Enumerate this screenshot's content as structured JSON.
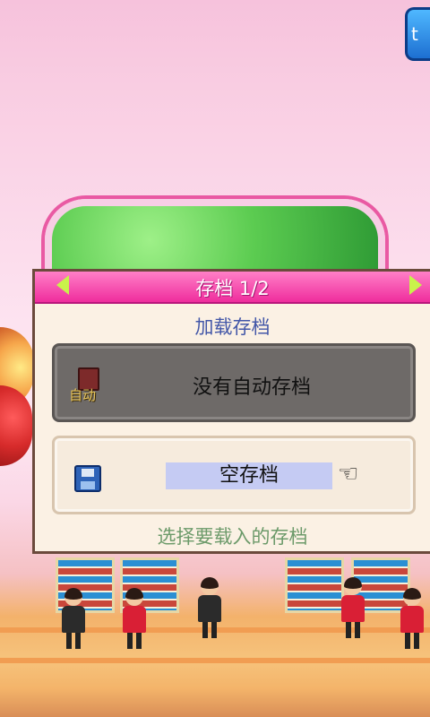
{
  "header": {
    "title": "存档 1/2"
  },
  "dialog": {
    "section_title": "加载存档",
    "slots": [
      {
        "icon_text": "自动",
        "label": "没有自动存档",
        "state": "disabled"
      },
      {
        "label": "空存档",
        "state": "selected"
      }
    ],
    "hint": "选择要载入的存档"
  },
  "icons": {
    "prev": "left-arrow-icon",
    "next": "right-arrow-icon",
    "hand": "pointing-hand-icon",
    "disk": "save-disk-icon",
    "auto": "auto-save-icon"
  },
  "colors": {
    "header": "#ef2d9d",
    "arrow": "#c9f24b",
    "section_title": "#4357a8",
    "hint": "#6c9a6a",
    "selected_highlight": "#c5cbf3"
  }
}
